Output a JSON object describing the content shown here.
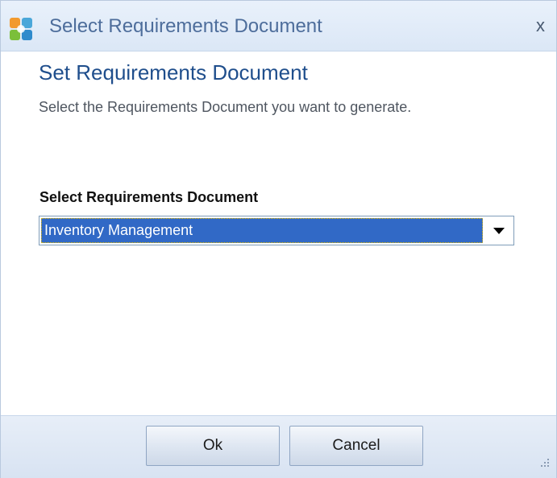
{
  "window": {
    "title": "Select Requirements Document",
    "close_label": "x"
  },
  "content": {
    "heading": "Set Requirements Document",
    "description": "Select the Requirements Document you want to generate.",
    "field_label": "Select Requirements Document",
    "select_value": "Inventory Management"
  },
  "footer": {
    "ok_label": "Ok",
    "cancel_label": "Cancel"
  },
  "icons": {
    "app": "app-logo-icon",
    "dropdown": "chevron-down-icon",
    "resize": "resize-grip-icon"
  },
  "colors": {
    "heading": "#1f4e8c",
    "selection": "#3169c6",
    "titlebar": "#dbe7f6"
  }
}
